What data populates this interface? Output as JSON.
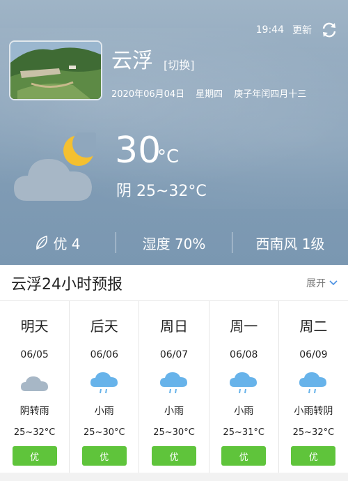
{
  "header": {
    "time": "19:44",
    "refresh_label": "更新",
    "city": "云浮",
    "switch_label": "[切换]",
    "date": "2020年06月04日",
    "weekday": "星期四",
    "lunar": "庚子年闰四月十三"
  },
  "current": {
    "temp": "30",
    "unit": "°C",
    "condition_range": "阴 25~32°C",
    "icon": "cloudy-night-icon"
  },
  "stats": {
    "air_quality": "优 4",
    "humidity": "湿度 70%",
    "wind": "西南风 1级"
  },
  "forecast": {
    "title": "云浮24小时预报",
    "expand_label": "展开",
    "days": [
      {
        "name": "明天",
        "date": "06/05",
        "condition": "阴转雨",
        "range": "25~32°C",
        "aqi": "优",
        "icon": "cloud-icon"
      },
      {
        "name": "后天",
        "date": "06/06",
        "condition": "小雨",
        "range": "25~30°C",
        "aqi": "优",
        "icon": "light-rain-icon"
      },
      {
        "name": "周日",
        "date": "06/07",
        "condition": "小雨",
        "range": "25~30°C",
        "aqi": "优",
        "icon": "light-rain-icon"
      },
      {
        "name": "周一",
        "date": "06/08",
        "condition": "小雨",
        "range": "25~31°C",
        "aqi": "优",
        "icon": "light-rain-icon"
      },
      {
        "name": "周二",
        "date": "06/09",
        "condition": "小雨转阴",
        "range": "25~32°C",
        "aqi": "优",
        "icon": "light-rain-icon"
      }
    ]
  },
  "colors": {
    "sky_top": "#9fb4c6",
    "sky_bottom": "#7a97b1",
    "aqi_good": "#5fc43b",
    "rain_icon": "#67b3ea",
    "cloud_icon": "#a7b7c6",
    "moon": "#f5c030"
  }
}
